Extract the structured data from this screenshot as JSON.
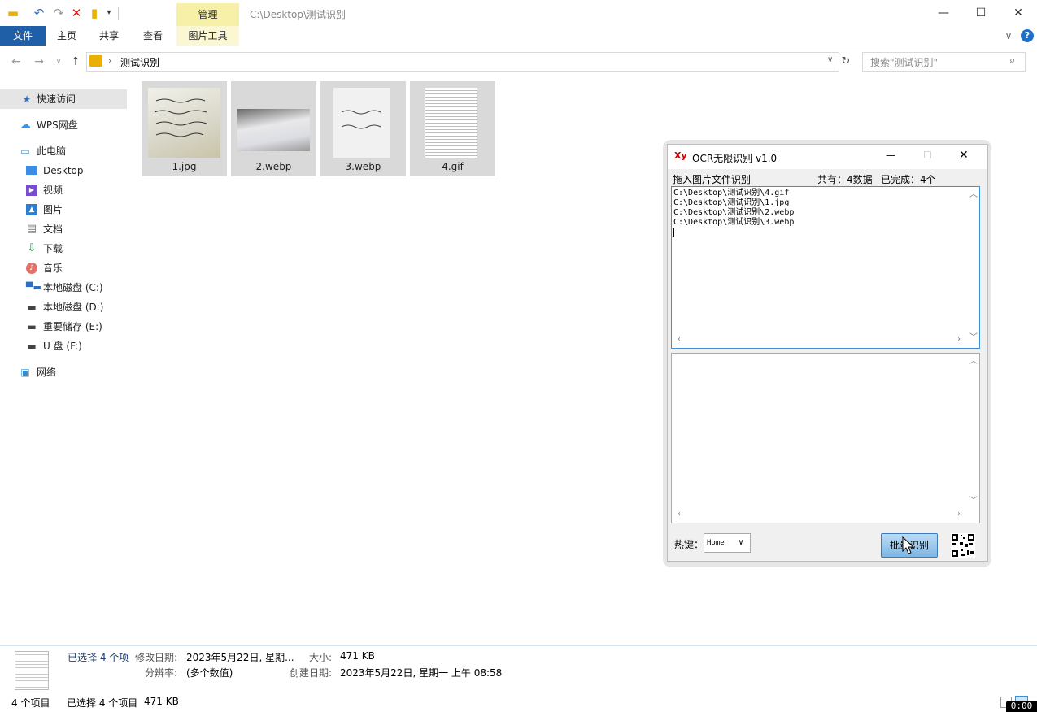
{
  "titlebar": {
    "context_tab": "管理",
    "path": "C:\\Desktop\\测试识别",
    "minimize": "—",
    "maximize": "☐",
    "close": "✕"
  },
  "ribbon": {
    "tabs": [
      "文件",
      "主页",
      "共享",
      "查看"
    ],
    "picture_tools": "图片工具",
    "chevron": "∨",
    "help": "?"
  },
  "address": {
    "folder": "测试识别",
    "search_placeholder": "搜索\"测试识别\""
  },
  "sidebar": {
    "items": [
      {
        "label": "快速访问",
        "icon": "star-icon"
      },
      {
        "label": "WPS网盘",
        "icon": "cloud-icon"
      },
      {
        "label": "此电脑",
        "icon": "computer-icon"
      },
      {
        "label": "Desktop",
        "icon": "desktop-icon"
      },
      {
        "label": "视频",
        "icon": "video-icon"
      },
      {
        "label": "图片",
        "icon": "picture-icon"
      },
      {
        "label": "文档",
        "icon": "document-icon"
      },
      {
        "label": "下载",
        "icon": "download-icon"
      },
      {
        "label": "音乐",
        "icon": "music-icon"
      },
      {
        "label": "本地磁盘 (C:)",
        "icon": "drive-icon"
      },
      {
        "label": "本地磁盘 (D:)",
        "icon": "drive-icon"
      },
      {
        "label": "重要储存 (E:)",
        "icon": "drive-icon"
      },
      {
        "label": "U 盘 (F:)",
        "icon": "drive-icon"
      },
      {
        "label": "网络",
        "icon": "network-icon"
      }
    ]
  },
  "files": [
    {
      "name": "1.jpg"
    },
    {
      "name": "2.webp"
    },
    {
      "name": "3.webp"
    },
    {
      "name": "4.gif"
    }
  ],
  "ocr": {
    "title": "OCR无限识别 v1.0",
    "drag_label": "拖入图片文件识别",
    "total": "共有：4数据",
    "done": "已完成：4个",
    "paths": [
      "C:\\Desktop\\测试识别\\4.gif",
      "C:\\Desktop\\测试识别\\1.jpg",
      "C:\\Desktop\\测试识别\\2.webp",
      "C:\\Desktop\\测试识别\\3.webp"
    ],
    "hotkey_label": "热键：",
    "hotkey_value": "Home",
    "batch_button": "批量识别"
  },
  "details": {
    "selected": "已选择 4 个项",
    "modified_label": "修改日期:",
    "modified_value": "2023年5月22日, 星期...",
    "size_label": "大小:",
    "size_value": "471 KB",
    "resolution_label": "分辨率:",
    "resolution_value": "(多个数值)",
    "created_label": "创建日期:",
    "created_value": "2023年5月22日, 星期一 上午 08:58"
  },
  "statusbar": {
    "count": "4 个项目",
    "selected": "已选择 4 个项目",
    "size": "471 KB",
    "timer": "0:00"
  }
}
